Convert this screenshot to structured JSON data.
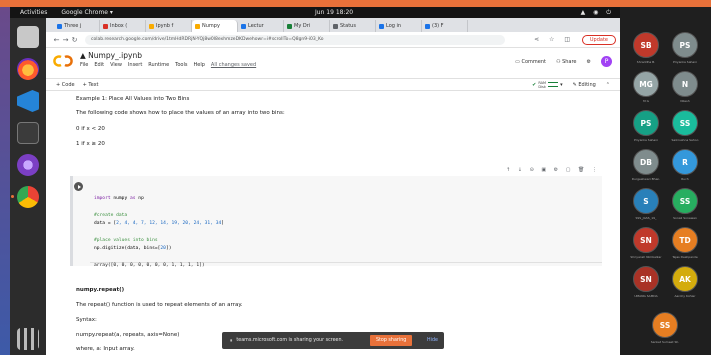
{
  "topbar": {
    "activities": "Activities",
    "app": "Google Chrome ▾",
    "clock": "Jun 19 18:20"
  },
  "tabs": [
    {
      "label": "Three j",
      "color": "#1a73e8"
    },
    {
      "label": "Inbox (",
      "color": "#d93025"
    },
    {
      "label": "Ipynb f",
      "color": "#f9ab00"
    },
    {
      "label": "Numpy",
      "color": "#f9ab00"
    },
    {
      "label": "Lectur",
      "color": "#1a73e8"
    },
    {
      "label": "My Dri",
      "color": "#188038"
    },
    {
      "label": "Status",
      "color": "#5f6368"
    },
    {
      "label": "Log in",
      "color": "#1a73e8"
    },
    {
      "label": "(3) F",
      "color": "#1a73e8"
    }
  ],
  "address": {
    "url": "colab.research.google.com/drive/1tmHdRDRjN-YQj8w0l8exhmzeDKDwehowr=i#scrollTo=Q8gn9-i03_Ko",
    "update_label": "Update"
  },
  "notebook": {
    "title": "Numpy_.ipynb",
    "menus": [
      "File",
      "Edit",
      "View",
      "Insert",
      "Runtime",
      "Tools",
      "Help"
    ],
    "saved": "All changes saved",
    "comment": "Comment",
    "share": "Share",
    "user_initial": "P"
  },
  "toolbar": {
    "code": "+ Code",
    "text": "+ Text",
    "ram": "RAM",
    "disk": "Disk",
    "editing": "Editing"
  },
  "content": {
    "heading": "Example 1: Place All Values into Two Bins",
    "desc": "The following code shows how to place the values of an array into two bins:",
    "rule1": "0 if x < 20",
    "rule2": "1 if x ≥ 20",
    "code": {
      "l1_kw1": "import",
      "l1_mod": " numpy ",
      "l1_kw2": "as",
      "l1_alias": " np",
      "l2": "#create data",
      "l3_pre": "data = [",
      "l3_nums": "2, 4, 4, 7, 12, 14, 19, 20, 24, 31, 34",
      "l3_post": "]",
      "l4": "#place values into bins",
      "l5_pre": "np.digitize(data, bins=[",
      "l5_num": "20",
      "l5_post": "])",
      "out": "array([0, 0, 0, 0, 0, 0, 0, 1, 1, 1, 1])"
    },
    "sec_title": "numpy.repeat()",
    "sec_desc": "The repeat() function is used to repeat elements of an array.",
    "syntax_label": "Syntax:",
    "syntax": "numpy.repeat(a, repeats, axis=None)",
    "where": "where, a: Input array."
  },
  "toast": {
    "message": "teams.microsoft.com is sharing your screen.",
    "stop": "Stop sharing",
    "hide": "Hide"
  },
  "participants": [
    {
      "initials": "SB",
      "name": "Shraddha B.",
      "color": "#c0392b"
    },
    {
      "initials": "PS",
      "name": "Priyanka Sahani",
      "color": "#7f8c8d"
    },
    {
      "initials": "MG",
      "name": "M G",
      "color": "#95a5a6"
    },
    {
      "initials": "N",
      "name": "Nilesh",
      "color": "#7f8c8d"
    },
    {
      "initials": "PS",
      "name": "Priyanka Sahani",
      "color": "#16a085"
    },
    {
      "initials": "SS",
      "name": "Saikrushna Sahoo",
      "color": "#1abc9c"
    },
    {
      "initials": "DB",
      "name": "Durgeshwari Bhan.",
      "color": "#7f8c8d"
    },
    {
      "initials": "R",
      "name": "Ruch",
      "color": "#3498db"
    },
    {
      "initials": "S",
      "name": "SSS_JGSS_19_",
      "color": "#2980b9"
    },
    {
      "initials": "SS",
      "name": "Sonali Sonawan",
      "color": "#27ae60"
    },
    {
      "initials": "SN",
      "name": "Shriyansh Nimbalkar",
      "color": "#c0392b"
    },
    {
      "initials": "TD",
      "name": "Tejas Deshpande",
      "color": "#e67e22"
    },
    {
      "initials": "SN",
      "name": "UMANG SAMDA",
      "color": "#a93226"
    },
    {
      "initials": "AK",
      "name": "Aarohy Kohler",
      "color": "#d4ac0d"
    },
    {
      "initials": "SS",
      "name": "Sanket Sumeet Sh.",
      "color": "#e67e22"
    }
  ]
}
